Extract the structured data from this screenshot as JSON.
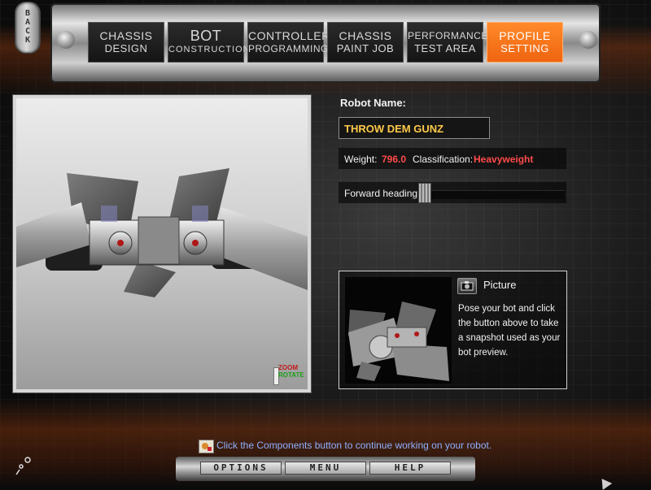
{
  "back_button": {
    "label": "B\nA\nC\nK"
  },
  "nav": {
    "tabs": [
      {
        "line1": "CHASSIS",
        "line2": "DESIGN",
        "active": false
      },
      {
        "line1": "BOT",
        "line2": "CONSTRUCTION",
        "active": false
      },
      {
        "line1": "CONTROLLER",
        "line2": "PROGRAMMING",
        "active": false
      },
      {
        "line1": "CHASSIS",
        "line2": "PAINT JOB",
        "active": false
      },
      {
        "line1": "PERFORMANCE",
        "line2": "TEST AREA",
        "active": false
      },
      {
        "line1": "PROFILE",
        "line2": "SETTING",
        "active": true
      }
    ]
  },
  "viewport": {
    "controls": {
      "zoom_label": "ZOOM",
      "rotate_label": "ROTATE"
    }
  },
  "profile": {
    "robot_name_label": "Robot Name:",
    "robot_name": "THROW DEM GUNZ",
    "weight_label": "Weight:",
    "weight_value": "796.0",
    "classification_label": "Classification:",
    "classification_value": "Heavyweight",
    "forward_heading_label": "Forward heading:"
  },
  "picture": {
    "title": "Picture",
    "instructions": "Pose your bot and click the button above to take a snapshot used as your bot preview."
  },
  "hint": {
    "text": "Click the Components button to continue working on your robot."
  },
  "bottom_bar": {
    "options_label": "OPTIONS",
    "menu_label": "MENU",
    "help_label": "HELP"
  },
  "colors": {
    "accent_active_tab": "#f06a14",
    "robot_name_text": "#ffc94a",
    "stat_value_text": "#ff4a4a",
    "hint_text": "#8fb0ff"
  },
  "icons": {
    "camera": "camera-icon",
    "hint": "hint-icon",
    "loading": "loading-icon"
  }
}
